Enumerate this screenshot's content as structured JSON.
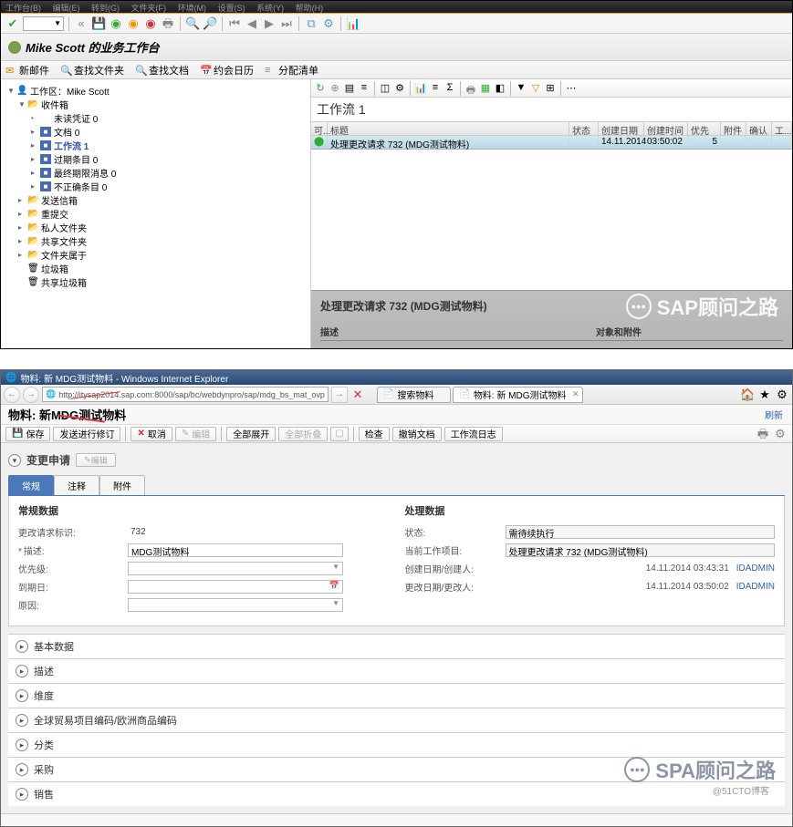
{
  "s1": {
    "menu": [
      "工作台(B)",
      "编辑(E)",
      "转到(G)",
      "文件夹(F)",
      "环境(M)",
      "设置(S)",
      "系统(Y)",
      "帮助(H)"
    ],
    "header_title": "Mike Scott 的业务工作台",
    "sub_buttons": [
      {
        "icon": "mail",
        "label": "新邮件"
      },
      {
        "icon": "search",
        "label": "查找文件夹"
      },
      {
        "icon": "search",
        "label": "查找文档"
      },
      {
        "icon": "cal",
        "label": "约会日历"
      },
      {
        "icon": "list",
        "label": "分配清单"
      }
    ],
    "tree": [
      {
        "lvl": 0,
        "toggle": "▼",
        "ic": "👤",
        "txt": "工作区：Mike Scott"
      },
      {
        "lvl": 1,
        "toggle": "▼",
        "ic": "📂",
        "cls": "folder-yellow",
        "txt": "收件箱"
      },
      {
        "lvl": 2,
        "toggle": "•",
        "ic": "",
        "txt": "未读凭证 0"
      },
      {
        "lvl": 2,
        "toggle": "▸",
        "ic": "■",
        "cls": "folder-blue",
        "txt": "文档 0"
      },
      {
        "lvl": 2,
        "toggle": "▸",
        "ic": "■",
        "cls": "folder-blue",
        "txt": "工作流 1",
        "sel": true
      },
      {
        "lvl": 2,
        "toggle": "▸",
        "ic": "■",
        "cls": "folder-blue",
        "txt": "过期条目 0"
      },
      {
        "lvl": 2,
        "toggle": "▸",
        "ic": "■",
        "cls": "folder-blue",
        "txt": "最终期限消息 0"
      },
      {
        "lvl": 2,
        "toggle": "▸",
        "ic": "■",
        "cls": "folder-blue",
        "txt": "不正确条目 0"
      },
      {
        "lvl": 1,
        "toggle": "▸",
        "ic": "📂",
        "cls": "folder-yellow",
        "txt": "发送信箱"
      },
      {
        "lvl": 1,
        "toggle": "▸",
        "ic": "📂",
        "cls": "folder-yellow",
        "txt": "重提交"
      },
      {
        "lvl": 1,
        "toggle": "▸",
        "ic": "📂",
        "cls": "folder-yellow",
        "txt": "私人文件夹"
      },
      {
        "lvl": 1,
        "toggle": "▸",
        "ic": "📂",
        "cls": "folder-yellow",
        "txt": "共享文件夹"
      },
      {
        "lvl": 1,
        "toggle": "▸",
        "ic": "📂",
        "cls": "folder-yellow",
        "txt": "文件夹属于"
      },
      {
        "lvl": 1,
        "toggle": "",
        "ic": "🗑",
        "txt": "垃圾箱"
      },
      {
        "lvl": 1,
        "toggle": "",
        "ic": "🗑",
        "txt": "共享垃圾箱"
      }
    ],
    "workflow_title": "工作流 1",
    "grid_headers": [
      "可...",
      "标题",
      "状态",
      "创建日期",
      "创建时间",
      "优先级",
      "附件",
      "确认",
      "工..."
    ],
    "grid_row": {
      "title": "处理更改请求 732 (MDG测试物料)",
      "date": "14.11.2014",
      "time": "03:50:02",
      "priority": "5"
    },
    "preview_title": "处理更改请求  732 (MDG测试物料)",
    "preview_left": "描述",
    "preview_right": "对象和附件",
    "watermark": "SAP顾问之路"
  },
  "s2": {
    "ie_title": "物料: 新 MDG测试物料 - Windows Internet Explorer",
    "url": "http://itysap2014.sap.com:8000/sap/bc/webdynpro/sap/mdg_bs_mat_ovp",
    "tab1": "搜索物料",
    "tab2": "物料: 新 MDG测试物料",
    "page_title_pre": "物料: 新  ",
    "page_title_em": "MDG测试物料",
    "refresh": "刷新",
    "actions": {
      "save": "保存",
      "send": "发送进行修订",
      "cancel": "取消",
      "edit": "编辑",
      "expand": "全部展开",
      "collapse": "全部折叠",
      "check": "检查",
      "cancel_doc": "撤销文档",
      "log": "工作流日志"
    },
    "section_title": "变更申请",
    "pill_btn": "编辑",
    "inner_tabs": [
      "常规",
      "注释",
      "附件"
    ],
    "left_title": "常规数据",
    "right_title": "处理数据",
    "left_rows": [
      {
        "label": "更改请求标识:",
        "req": false,
        "val": "732",
        "type": "static"
      },
      {
        "label": "描述:",
        "req": true,
        "val": "MDG测试物料",
        "type": "input"
      },
      {
        "label": "优先级:",
        "req": false,
        "val": "",
        "type": "drop"
      },
      {
        "label": "到期日:",
        "req": false,
        "val": "",
        "type": "date"
      },
      {
        "label": "原因:",
        "req": false,
        "val": "",
        "type": "drop"
      }
    ],
    "right_rows": [
      {
        "label": "状态:",
        "val": "需待续执行",
        "type": "box"
      },
      {
        "label": "当前工作项目:",
        "val": "处理更改请求 732 (MDG测试物料)",
        "type": "box"
      },
      {
        "label": "创建日期/创建人:",
        "date": "14.11.2014 03:43:31",
        "user": "IDADMIN"
      },
      {
        "label": "更改日期/更改人:",
        "date": "14.11.2014 03:50:02",
        "user": "IDADMIN"
      }
    ],
    "sections": [
      "基本数据",
      "描述",
      "维度",
      "全球贸易项目编码/欧洲商品编码",
      "分类",
      "采购",
      "销售"
    ],
    "watermark": "SPA顾问之路",
    "sub_wm": "@51CTO博客"
  }
}
